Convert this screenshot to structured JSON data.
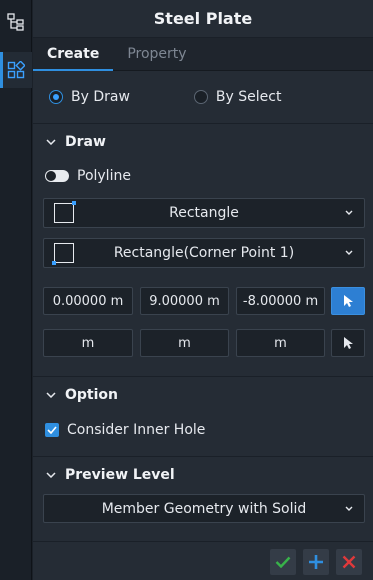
{
  "panel": {
    "title": "Steel Plate"
  },
  "tabs": [
    {
      "label": "Create"
    },
    {
      "label": "Property"
    }
  ],
  "mode": {
    "options": [
      {
        "label": "By Draw",
        "selected": true
      },
      {
        "label": "By Select",
        "selected": false
      }
    ]
  },
  "draw": {
    "header": "Draw",
    "polyline_label": "Polyline",
    "shape_dropdown": "Rectangle",
    "method_dropdown": "Rectangle(Corner Point 1)",
    "coords": [
      "0.00000 m",
      "9.00000 m",
      "-8.00000 m"
    ],
    "coords2": [
      "m",
      "m",
      "m"
    ]
  },
  "option": {
    "header": "Option",
    "consider_inner_hole": "Consider Inner Hole"
  },
  "preview": {
    "header": "Preview Level",
    "level": "Member Geometry with Solid"
  },
  "colors": {
    "accent": "#2f8fe0",
    "confirm": "#38b24a",
    "cancel": "#e0393b"
  }
}
